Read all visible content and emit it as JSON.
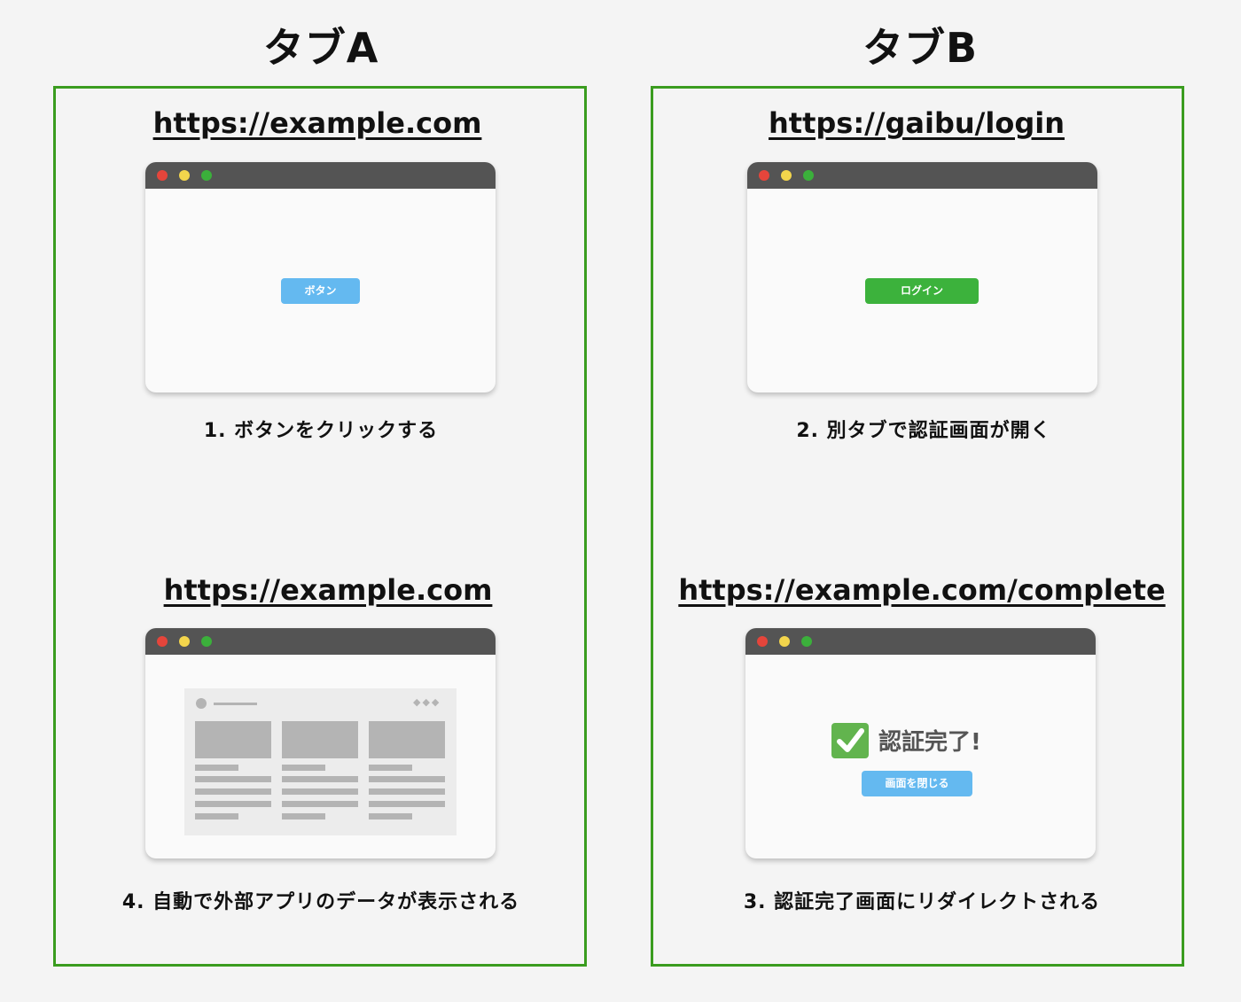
{
  "tabs": {
    "a": {
      "title": "タブA"
    },
    "b": {
      "title": "タブB"
    }
  },
  "steps": {
    "step1": {
      "url": "https://example.com",
      "button_label": "ボタン",
      "caption": "1. ボタンをクリックする",
      "button_color": "#64b9f0"
    },
    "step2": {
      "url": "https://gaibu/login",
      "button_label": "ログイン",
      "caption": "2. 別タブで認証画面が開く",
      "button_color": "#3cb23c"
    },
    "step3": {
      "url": "https://example.com/complete",
      "check_icon": "check-mark-icon",
      "message": "認証完了!",
      "button_label": "画面を閉じる",
      "caption": "3. 認証完了画面にリダイレクトされる",
      "button_color": "#64b9f0"
    },
    "step4": {
      "url": "https://example.com",
      "caption": "4. 自動で外部アプリのデータが表示される"
    }
  },
  "colors": {
    "panel_border": "#3a9c1f",
    "titlebar": "#545454",
    "dot_red": "#e5453b",
    "dot_yellow": "#f3d54c",
    "dot_green": "#3bb03b"
  }
}
